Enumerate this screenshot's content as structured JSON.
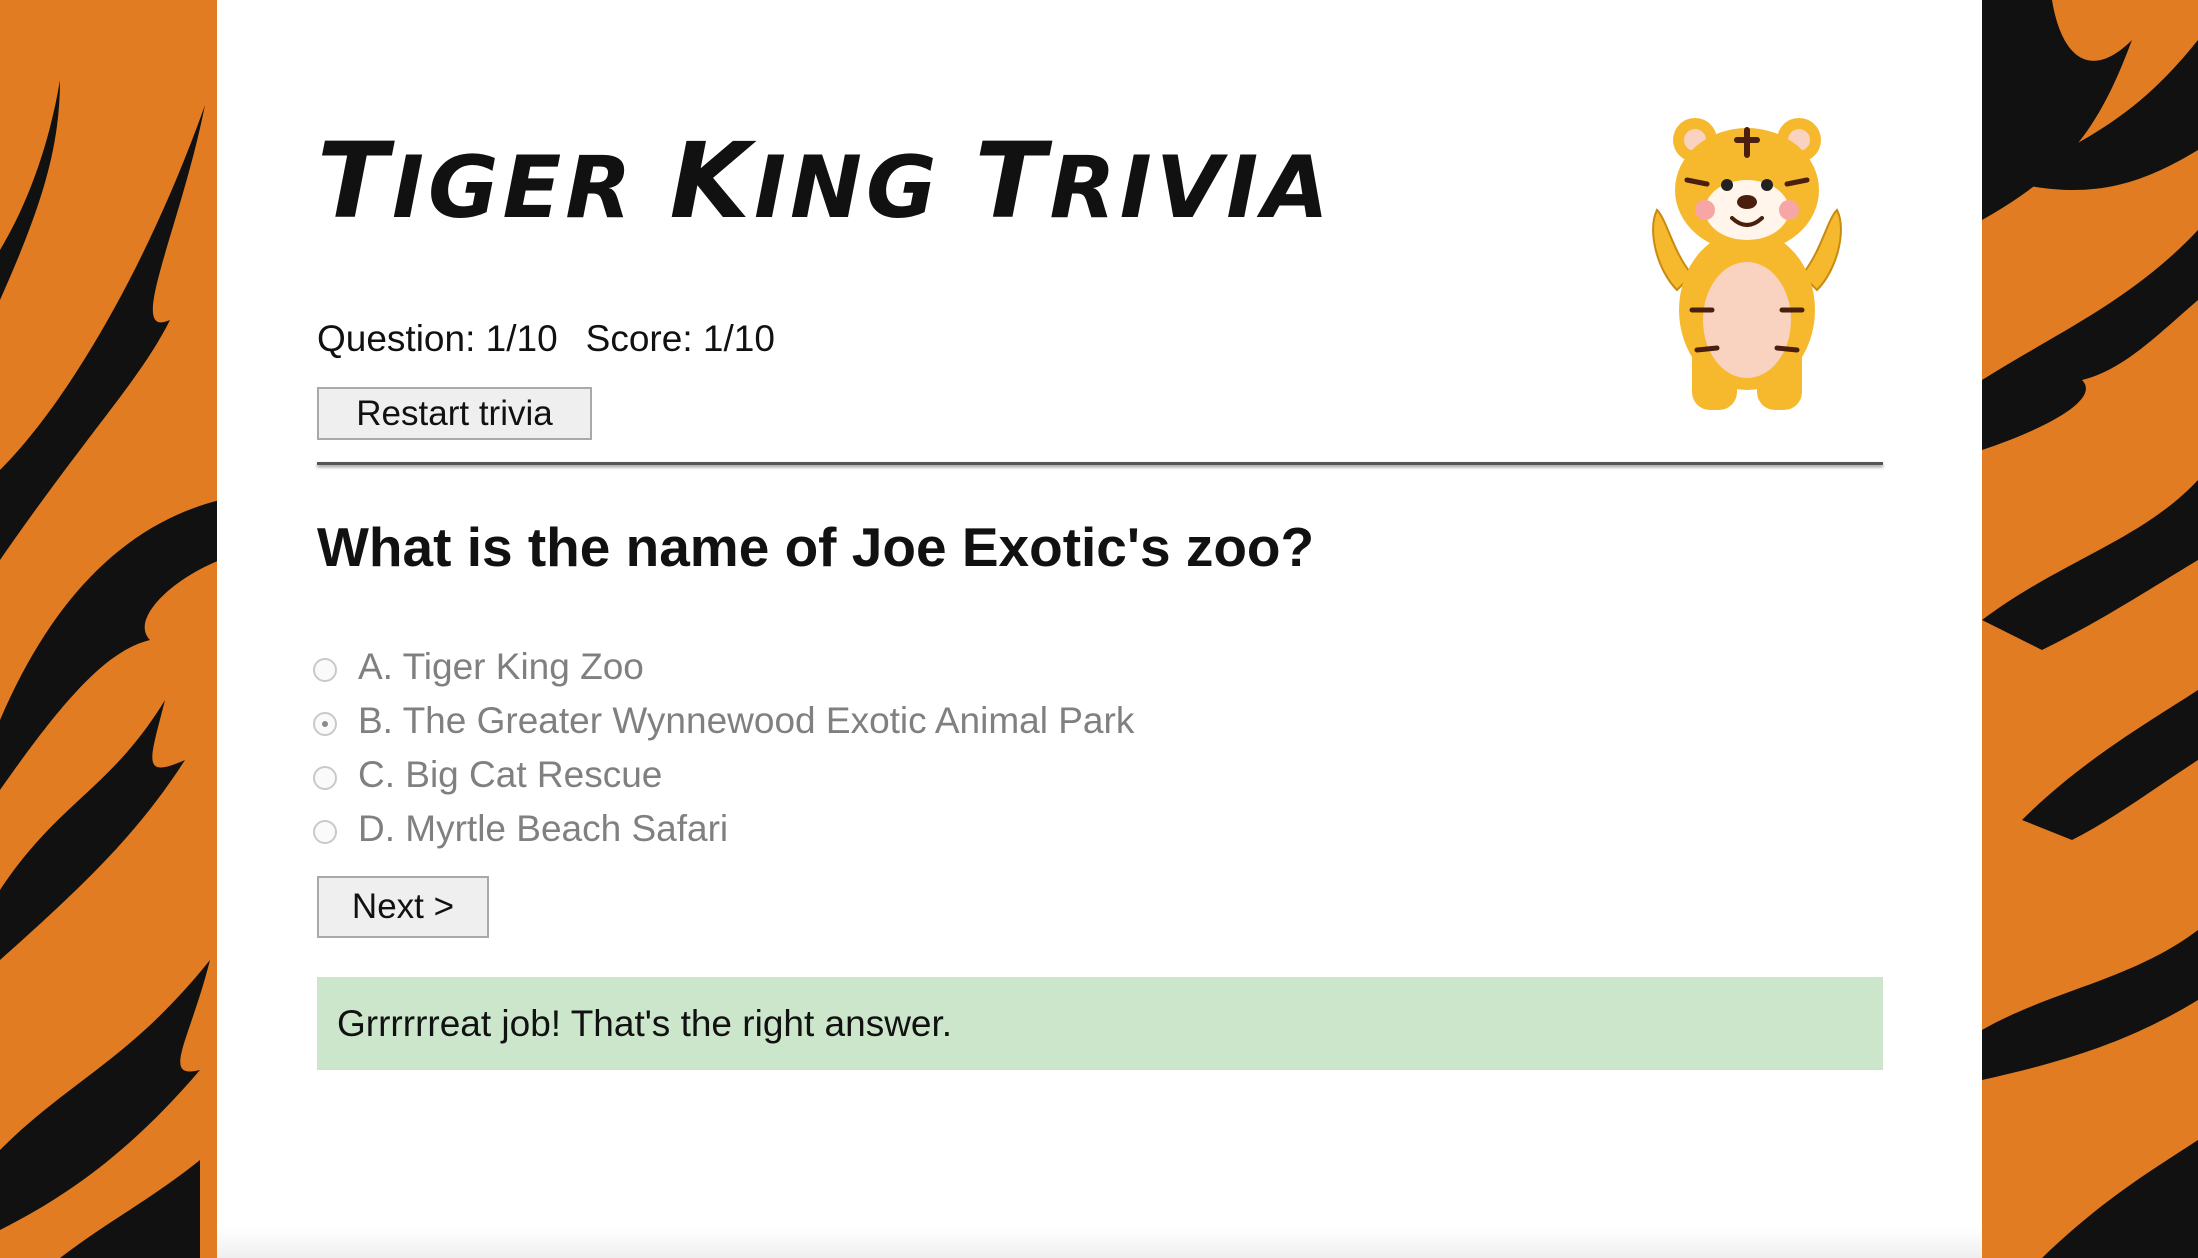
{
  "title": {
    "prefix": "T",
    "rest1": "IGER ",
    "k": "K",
    "rest2": "ING ",
    "t2": "T",
    "rest3": "RIVIA"
  },
  "status": {
    "question": "Question: 1/10",
    "score": "Score: 1/10"
  },
  "restart_label": "Restart trivia",
  "question_text": "What is the name of Joe Exotic's zoo?",
  "options": [
    {
      "label": "A. Tiger King Zoo",
      "selected": false
    },
    {
      "label": "B. The Greater Wynnewood Exotic Animal Park",
      "selected": true
    },
    {
      "label": "C. Big Cat Rescue",
      "selected": false
    },
    {
      "label": "D. Myrtle Beach Safari",
      "selected": false
    }
  ],
  "next_label": "Next >",
  "feedback": "Grrrrrreat job! That's the right answer.",
  "colors": {
    "background": "#e27c22",
    "stripe": "#111111",
    "feedback_bg": "#cce6cc"
  },
  "icons": {
    "mascot": "tiger-mascot-icon"
  }
}
